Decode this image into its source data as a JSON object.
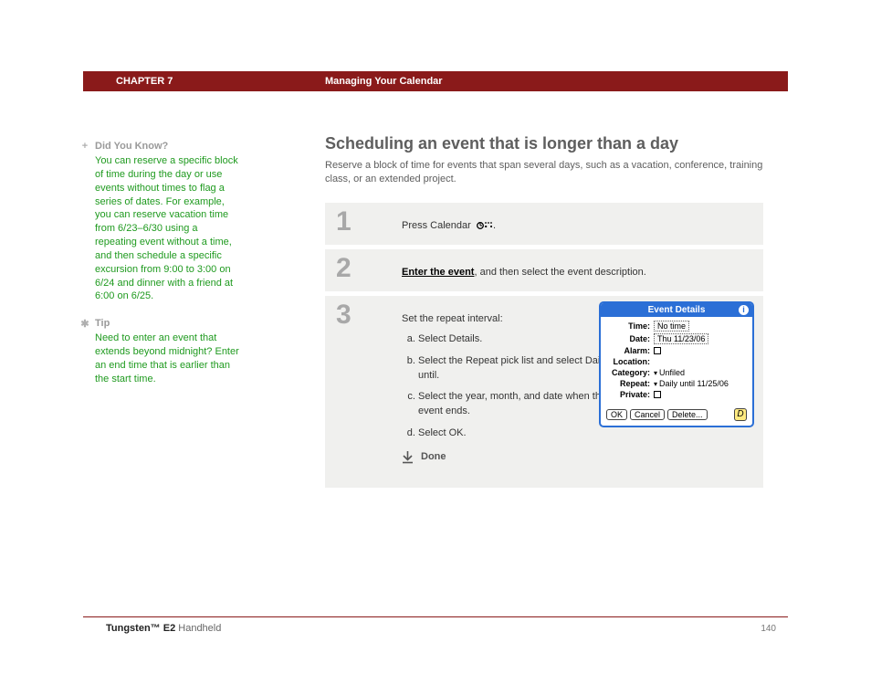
{
  "header": {
    "chapter": "CHAPTER 7",
    "title": "Managing Your Calendar"
  },
  "sidebar": {
    "didyouknow": {
      "label": "Did You Know?",
      "body": "You can reserve a specific block of time during the day or use events without times to flag a series of dates. For example, you can reserve vacation time from 6/23–6/30 using a repeating event without a time, and then schedule a specific excursion from 9:00 to 3:00 on 6/24 and dinner with a friend at 6:00 on 6/25."
    },
    "tip": {
      "label": "Tip",
      "body": "Need to enter an event that extends beyond midnight? Enter an end time that is earlier than the start time."
    }
  },
  "main": {
    "title": "Scheduling an event that is longer than a day",
    "intro": "Reserve a block of time for events that span several days, such as a vacation, conference, training class, or an extended project.",
    "steps": {
      "s1": {
        "num": "1",
        "text_a": "Press Calendar ",
        "text_b": "."
      },
      "s2": {
        "num": "2",
        "link": "Enter the event",
        "text_b": ", and then select the event description."
      },
      "s3": {
        "num": "3",
        "lead": "Set the repeat interval:",
        "a": "Select Details.",
        "b": "Select the Repeat pick list and select Daily until.",
        "c": "Select the year, month, and date when the event ends.",
        "d": "Select OK.",
        "done": "Done"
      }
    }
  },
  "dialog": {
    "title": "Event Details",
    "info": "i",
    "rows": {
      "time_label": "Time:",
      "time_val": "No time",
      "date_label": "Date:",
      "date_val": "Thu 11/23/06",
      "alarm_label": "Alarm:",
      "location_label": "Location:",
      "category_label": "Category:",
      "category_val": "Unfiled",
      "repeat_label": "Repeat:",
      "repeat_val": "Daily until 11/25/06",
      "private_label": "Private:"
    },
    "buttons": {
      "ok": "OK",
      "cancel": "Cancel",
      "delete": "Delete...",
      "note": "D"
    }
  },
  "footer": {
    "product_bold": "Tungsten™ E2",
    "product_rest": " Handheld",
    "page": "140"
  }
}
